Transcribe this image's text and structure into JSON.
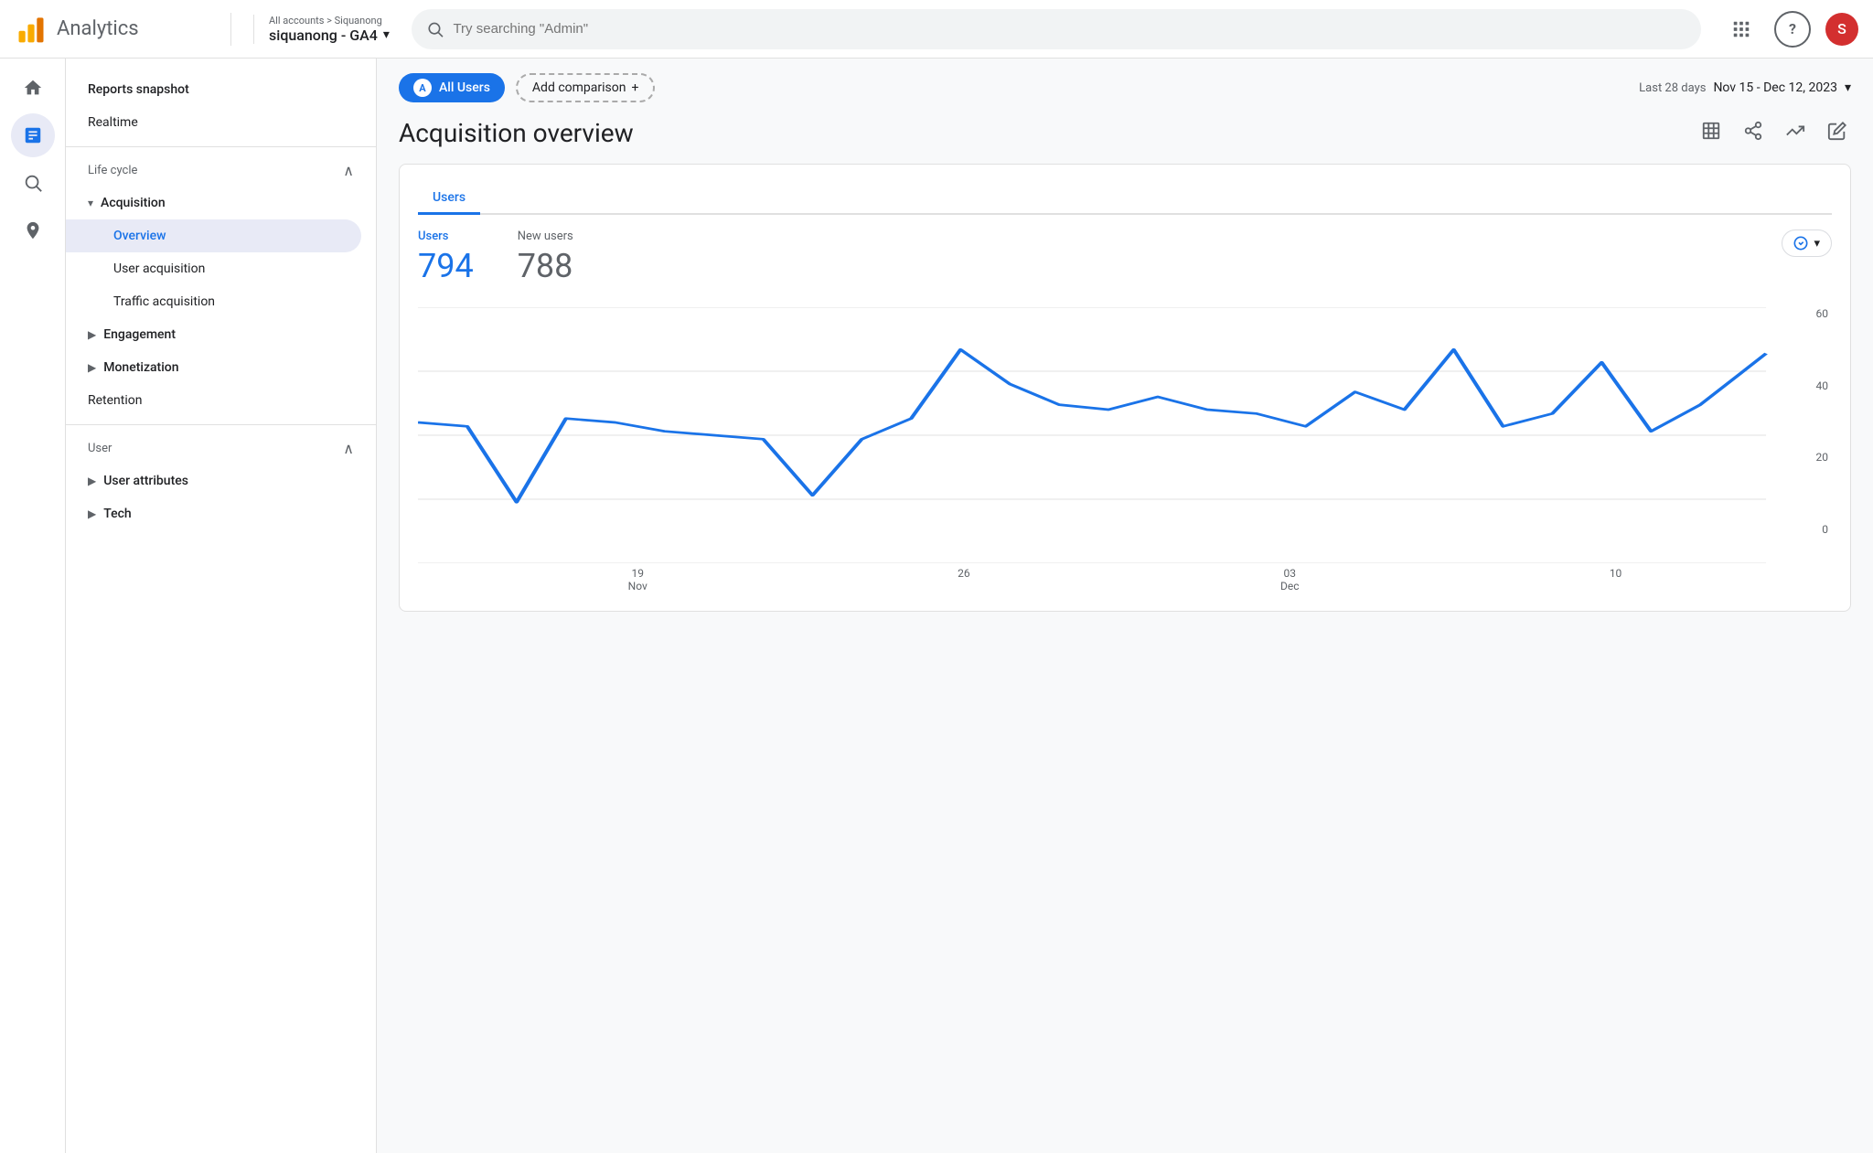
{
  "app": {
    "name": "Analytics"
  },
  "topbar": {
    "breadcrumb": "All accounts > Siquanong",
    "account_name": "siquanong - GA4",
    "search_placeholder": "Try searching \"Admin\"",
    "user_initial": "S"
  },
  "icon_sidebar": {
    "items": [
      {
        "name": "home-icon",
        "icon": "⌂",
        "active": false
      },
      {
        "name": "reports-icon",
        "icon": "📊",
        "active": true
      },
      {
        "name": "explore-icon",
        "icon": "🔍",
        "active": false
      },
      {
        "name": "advertising-icon",
        "icon": "📡",
        "active": false
      }
    ]
  },
  "nav_sidebar": {
    "top_items": [
      {
        "label": "Reports snapshot",
        "type": "top"
      },
      {
        "label": "Realtime",
        "type": "top"
      }
    ],
    "sections": [
      {
        "title": "Life cycle",
        "collapsed": false,
        "items": [
          {
            "label": "Acquisition",
            "type": "section-header",
            "expanded": true
          },
          {
            "label": "Overview",
            "type": "child",
            "active": true
          },
          {
            "label": "User acquisition",
            "type": "child"
          },
          {
            "label": "Traffic acquisition",
            "type": "child"
          },
          {
            "label": "Engagement",
            "type": "section-header",
            "expanded": false
          },
          {
            "label": "Monetization",
            "type": "section-header",
            "expanded": false
          },
          {
            "label": "Retention",
            "type": "plain"
          }
        ]
      },
      {
        "title": "User",
        "collapsed": false,
        "items": [
          {
            "label": "User attributes",
            "type": "section-header",
            "expanded": false
          },
          {
            "label": "Tech",
            "type": "section-header",
            "expanded": false
          }
        ]
      }
    ]
  },
  "comparison_bar": {
    "all_users_label": "All Users",
    "add_comparison_label": "Add comparison",
    "date_range_label": "Last 28 days",
    "date_range_value": "Nov 15 - Dec 12, 2023"
  },
  "main": {
    "section_title": "Acquisition overview",
    "chart": {
      "tabs": [
        "Users"
      ],
      "active_tab": "Users",
      "metrics": [
        {
          "label": "Users",
          "value": "794",
          "style": "blue"
        },
        {
          "label": "New users",
          "value": "788",
          "style": "gray"
        }
      ],
      "y_labels": [
        "60",
        "40",
        "20",
        "0"
      ],
      "x_labels": [
        {
          "line1": "19",
          "line2": "Nov"
        },
        {
          "line1": "26",
          "line2": ""
        },
        {
          "line1": "03",
          "line2": "Dec"
        },
        {
          "line1": "10",
          "line2": ""
        }
      ],
      "data_points": [
        33,
        27,
        13,
        30,
        29,
        26,
        25,
        24,
        15,
        24,
        30,
        50,
        43,
        38,
        37,
        39,
        37,
        36,
        32,
        41,
        37,
        50,
        32,
        35,
        46,
        27,
        36,
        49
      ]
    }
  }
}
